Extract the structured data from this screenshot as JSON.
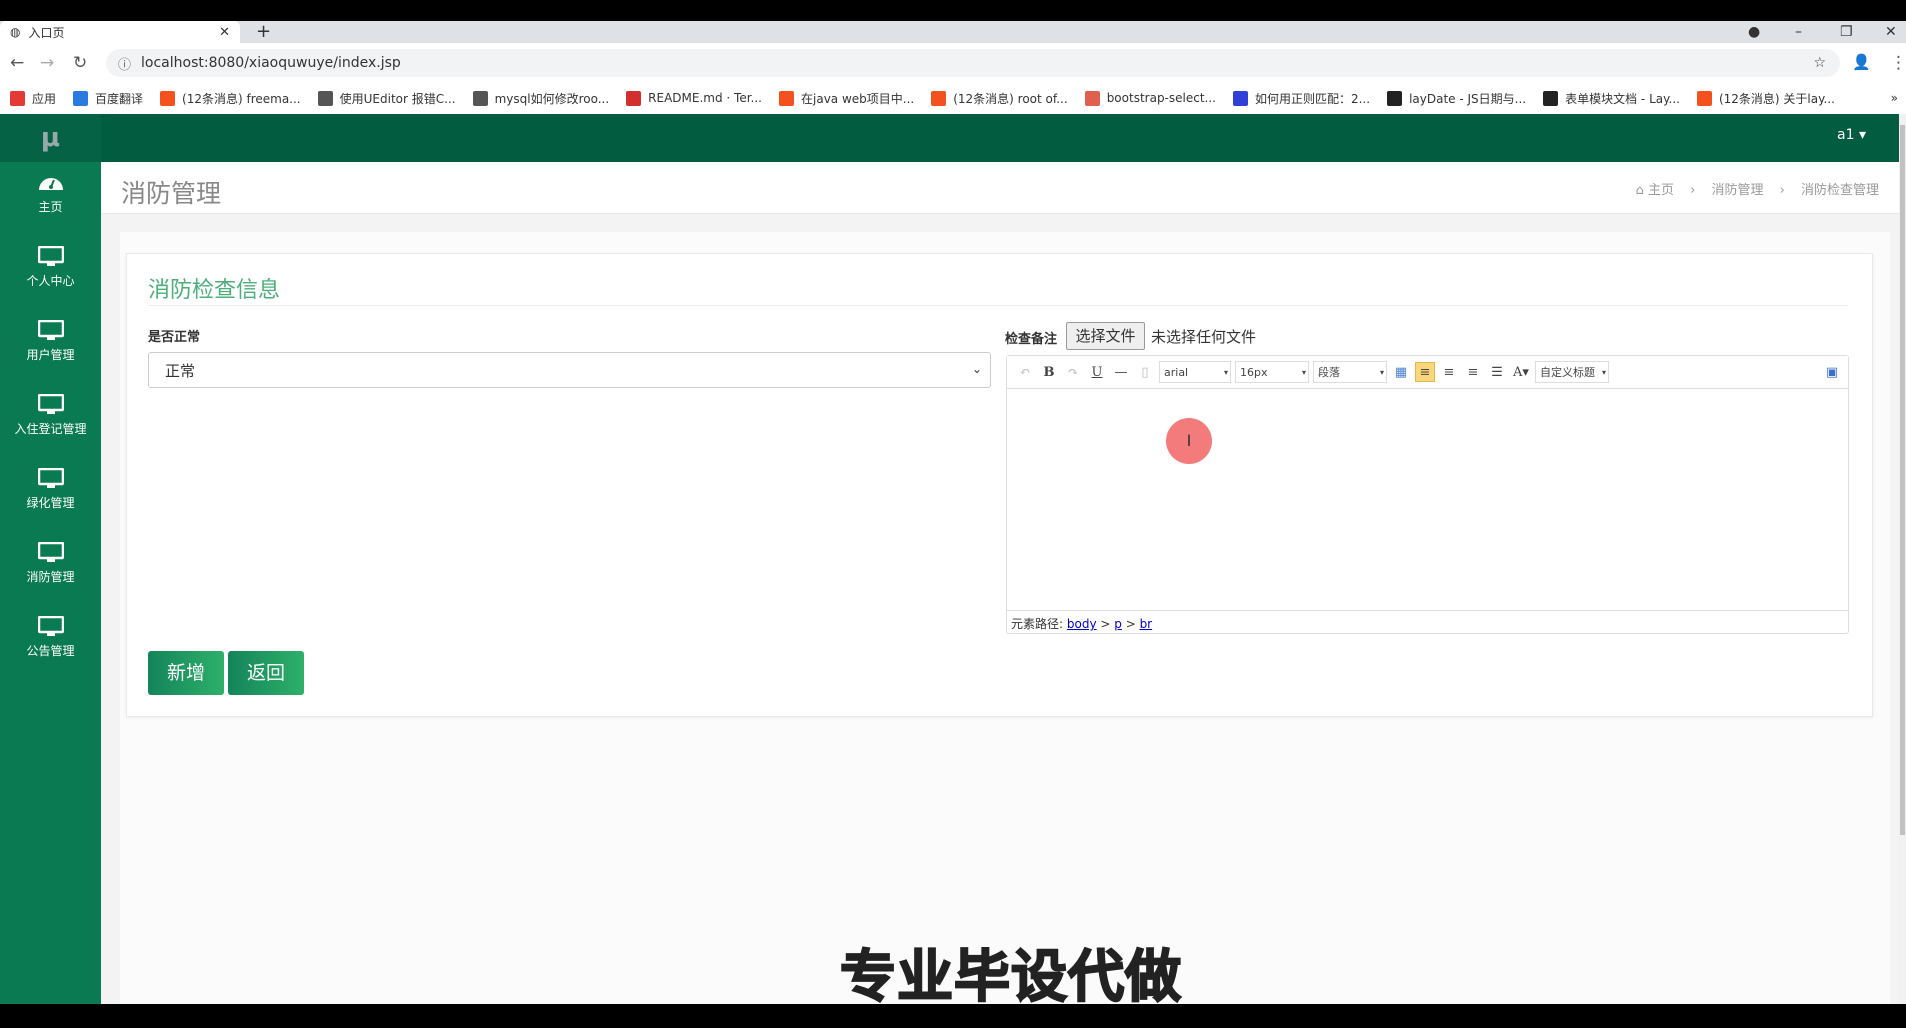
{
  "browser": {
    "tab_title": "入口页",
    "url": "localhost:8080/xiaoquwuye/index.jsp",
    "bookmarks": [
      {
        "label": "应用",
        "color": "#e53935"
      },
      {
        "label": "百度翻译",
        "color": "#2a7ae2"
      },
      {
        "label": "(12条消息) freema...",
        "color": "#f4511e"
      },
      {
        "label": "使用UEditor 报错C...",
        "color": "#555555"
      },
      {
        "label": "mysql如何修改roo...",
        "color": "#555555"
      },
      {
        "label": "README.md · Ter...",
        "color": "#d32f2f"
      },
      {
        "label": "在java web项目中...",
        "color": "#f4511e"
      },
      {
        "label": "(12条消息) root of...",
        "color": "#f4511e"
      },
      {
        "label": "bootstrap-select...",
        "color": "#e06050"
      },
      {
        "label": "如何用正则匹配：2...",
        "color": "#2f3fd8"
      },
      {
        "label": "layDate - JS日期与...",
        "color": "#222222"
      },
      {
        "label": "表单模块文档 - Lay...",
        "color": "#222222"
      },
      {
        "label": "(12条消息) 关于lay...",
        "color": "#f4511e"
      }
    ]
  },
  "app": {
    "logo": "μ",
    "user": "a1",
    "sidebar": [
      {
        "label": "主页",
        "icon": "dashboard-icon"
      },
      {
        "label": "个人中心",
        "icon": "monitor-icon"
      },
      {
        "label": "用户管理",
        "icon": "monitor-icon"
      },
      {
        "label": "入住登记管理",
        "icon": "monitor-icon"
      },
      {
        "label": "绿化管理",
        "icon": "monitor-icon"
      },
      {
        "label": "消防管理",
        "icon": "monitor-icon"
      },
      {
        "label": "公告管理",
        "icon": "monitor-icon"
      }
    ],
    "page_title": "消防管理",
    "breadcrumb": [
      "主页",
      "消防管理",
      "消防检查管理"
    ],
    "card_title": "消防检查信息",
    "field_normal_label": "是否正常",
    "field_normal_value": "正常",
    "field_remark_label": "检查备注",
    "file_button": "选择文件",
    "file_status": "未选择任何文件",
    "editor": {
      "font": "arial",
      "size": "16px",
      "paragraph": "段落",
      "custom_title": "自定义标题",
      "path_label": "元素路径:",
      "path": [
        "body",
        "p",
        "br"
      ]
    },
    "add_button": "新增",
    "back_button": "返回",
    "accent": "#0a7a52"
  },
  "watermark": "专业毕设代做"
}
